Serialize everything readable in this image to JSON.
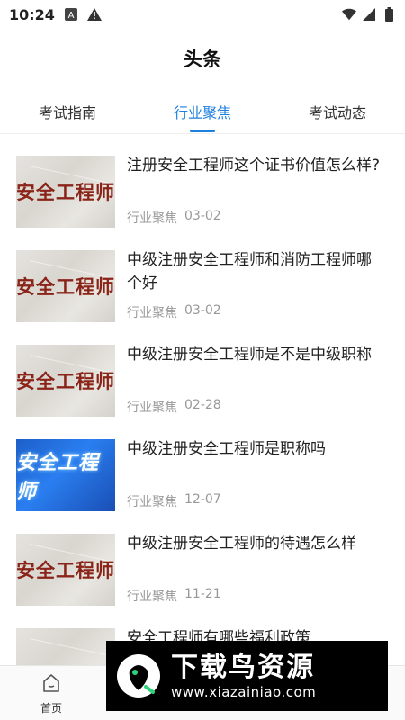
{
  "status_bar": {
    "time": "10:24",
    "icons": [
      "font-icon",
      "warning-icon",
      "wifi-icon",
      "signal-icon",
      "battery-icon"
    ]
  },
  "header": {
    "title": "头条"
  },
  "tabs": [
    {
      "label": "考试指南",
      "active": false
    },
    {
      "label": "行业聚焦",
      "active": true
    },
    {
      "label": "考试动态",
      "active": false
    }
  ],
  "articles": [
    {
      "title": "注册安全工程师这个证书价值怎么样?",
      "category": "行业聚焦",
      "date": "03-02",
      "thumb_text": "安全工程师",
      "thumb_style": "paper"
    },
    {
      "title": "中级注册安全工程师和消防工程师哪个好",
      "category": "行业聚焦",
      "date": "03-02",
      "thumb_text": "安全工程师",
      "thumb_style": "paper"
    },
    {
      "title": "中级注册安全工程师是不是中级职称",
      "category": "行业聚焦",
      "date": "02-28",
      "thumb_text": "安全工程师",
      "thumb_style": "paper"
    },
    {
      "title": "中级注册安全工程师是职称吗",
      "category": "行业聚焦",
      "date": "12-07",
      "thumb_text": "安全工程师",
      "thumb_style": "blue"
    },
    {
      "title": "中级注册安全工程师的待遇怎么样",
      "category": "行业聚焦",
      "date": "11-21",
      "thumb_text": "安全工程师",
      "thumb_style": "paper"
    },
    {
      "title": "安全工程师有哪些福利政策",
      "category": "",
      "date": "",
      "thumb_text": "",
      "thumb_style": "paper"
    }
  ],
  "bottom_nav": {
    "home_label": "首页"
  },
  "watermark": {
    "title": "下载鸟资源",
    "url": "www.xiazainiao.com"
  },
  "colors": {
    "accent": "#1d7fe0",
    "meta": "#999999",
    "thumb_red": "#8a2418"
  }
}
